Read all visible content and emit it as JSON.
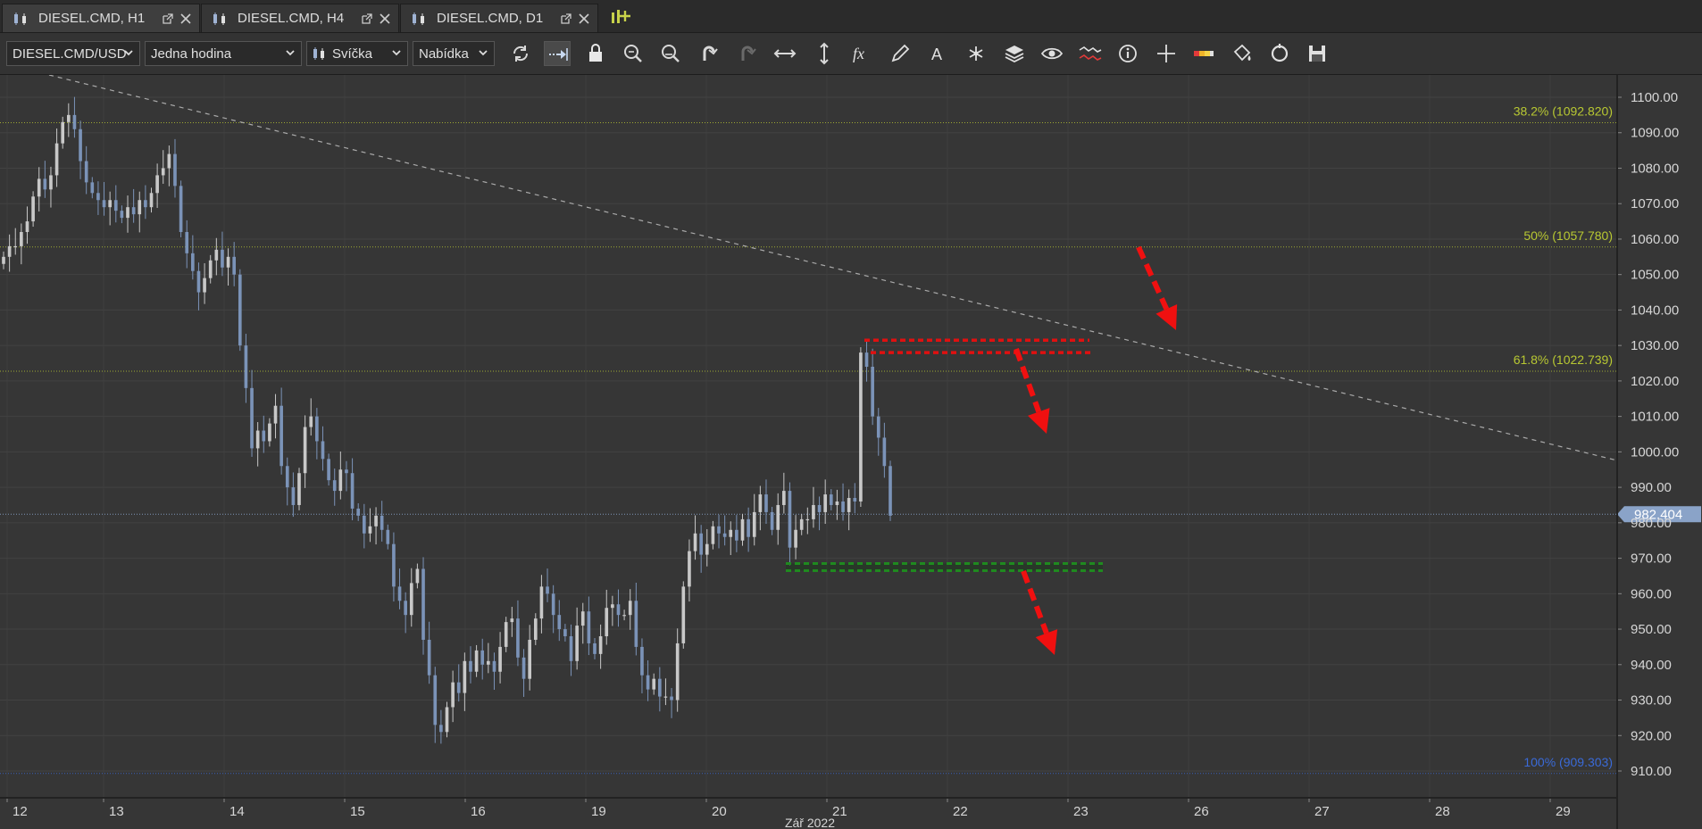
{
  "tabs": [
    {
      "label": "DIESEL.CMD, H1",
      "active": true
    },
    {
      "label": "DIESEL.CMD, H4",
      "active": false
    },
    {
      "label": "DIESEL.CMD, D1",
      "active": false
    }
  ],
  "toolbar": {
    "instrument": "DIESEL.CMD/USD",
    "period": "Jedna hodina",
    "chart_type": "Svíčka",
    "price_side": "Nabídka",
    "icons": [
      "refresh-icon",
      "autoshift-icon",
      "lock-icon",
      "zoom-in-icon",
      "zoom-out-icon",
      "undo-icon",
      "redo-icon",
      "horizontal-scale-icon",
      "vertical-scale-icon",
      "indicator-fx-icon",
      "pencil-icon",
      "text-tool-icon",
      "pattern-icon",
      "layers-icon",
      "eye-icon",
      "compare-icon",
      "info-icon",
      "crosshair-icon",
      "color-theme-icon",
      "fill-icon",
      "reset-icon",
      "save-icon"
    ]
  },
  "chart_data": {
    "type": "candlestick",
    "instrument": "DIESEL.CMD/USD",
    "timeframe": "H1",
    "ylim": [
      905,
      1105
    ],
    "y_ticks": [
      910,
      920,
      930,
      940,
      950,
      960,
      970,
      980,
      990,
      1000,
      1010,
      1020,
      1030,
      1040,
      1050,
      1060,
      1070,
      1080,
      1090,
      1100
    ],
    "y_tick_labels": [
      "910.00",
      "920.00",
      "930.00",
      "940.00",
      "950.00",
      "960.00",
      "970.00",
      "980.00",
      "990.00",
      "1000.00",
      "1010.00",
      "1020.00",
      "1030.00",
      "1040.00",
      "1050.00",
      "1060.00",
      "1070.00",
      "1080.00",
      "1090.00",
      "1100.00"
    ],
    "x_tick_labels": [
      "12",
      "13",
      "14",
      "15",
      "16",
      "19",
      "20",
      "21",
      "22",
      "23",
      "26",
      "27",
      "28",
      "29"
    ],
    "x_axis_caption": "Zář 2022",
    "current_price": 982.404,
    "current_price_label": "982.404",
    "fibonacci": [
      {
        "label": "38.2% (1092.820)",
        "value": 1092.82,
        "color": "#b8c832"
      },
      {
        "label": "50% (1057.780)",
        "value": 1057.78,
        "color": "#b8c832"
      },
      {
        "label": "61.8% (1022.739)",
        "value": 1022.739,
        "color": "#b8c832"
      },
      {
        "label": "100% (909.303)",
        "value": 909.303,
        "color": "#3a6ad8"
      }
    ],
    "candle_colors": {
      "up": "#c8c8c8",
      "down": "#7b93b8"
    },
    "closes": [
      1055,
      1058,
      1058,
      1062,
      1065,
      1072,
      1077,
      1074,
      1078,
      1087,
      1093,
      1095,
      1091,
      1082,
      1076,
      1073,
      1071,
      1069,
      1071,
      1068,
      1066,
      1069,
      1067,
      1071,
      1069,
      1073,
      1078,
      1080,
      1084,
      1075,
      1062,
      1056,
      1051,
      1045,
      1049,
      1054,
      1057,
      1052,
      1055,
      1050,
      1030,
      1018,
      1001,
      1006,
      1003,
      1008,
      1013,
      996,
      990,
      985,
      994,
      1007,
      1010,
      1003,
      998,
      992,
      989,
      995,
      994,
      984,
      982,
      977,
      979,
      982,
      978,
      974,
      962,
      958,
      954,
      963,
      967,
      947,
      937,
      923,
      921,
      928,
      935,
      932,
      941,
      938,
      944,
      940,
      941,
      938,
      945,
      952,
      953,
      942,
      936,
      947,
      953,
      962,
      960,
      954,
      950,
      948,
      941,
      951,
      955,
      946,
      943,
      948,
      956,
      957,
      954,
      954,
      958,
      945,
      937,
      933,
      936,
      931,
      931,
      930,
      946,
      962,
      972,
      977,
      971,
      974,
      979,
      977,
      976,
      978,
      975,
      981,
      976,
      983,
      988,
      983,
      978,
      985,
      989,
      973,
      978,
      981,
      981,
      985,
      983,
      988,
      985,
      986,
      983,
      987,
      986,
      1028,
      1024,
      1010,
      1004,
      996,
      982
    ],
    "annotations": {
      "trendline": {
        "style": "dashed",
        "color": "#aaaaaa"
      },
      "resistance_zone": {
        "color": "#e01010",
        "levels": [
          1028,
          1031.5
        ]
      },
      "support_zone": {
        "color": "#1f8a1f",
        "levels": [
          966.5,
          968.5
        ]
      },
      "arrows": [
        {
          "direction": "down",
          "color": "#f01010"
        },
        {
          "direction": "down",
          "color": "#f01010"
        },
        {
          "direction": "down",
          "color": "#f01010"
        }
      ]
    }
  }
}
